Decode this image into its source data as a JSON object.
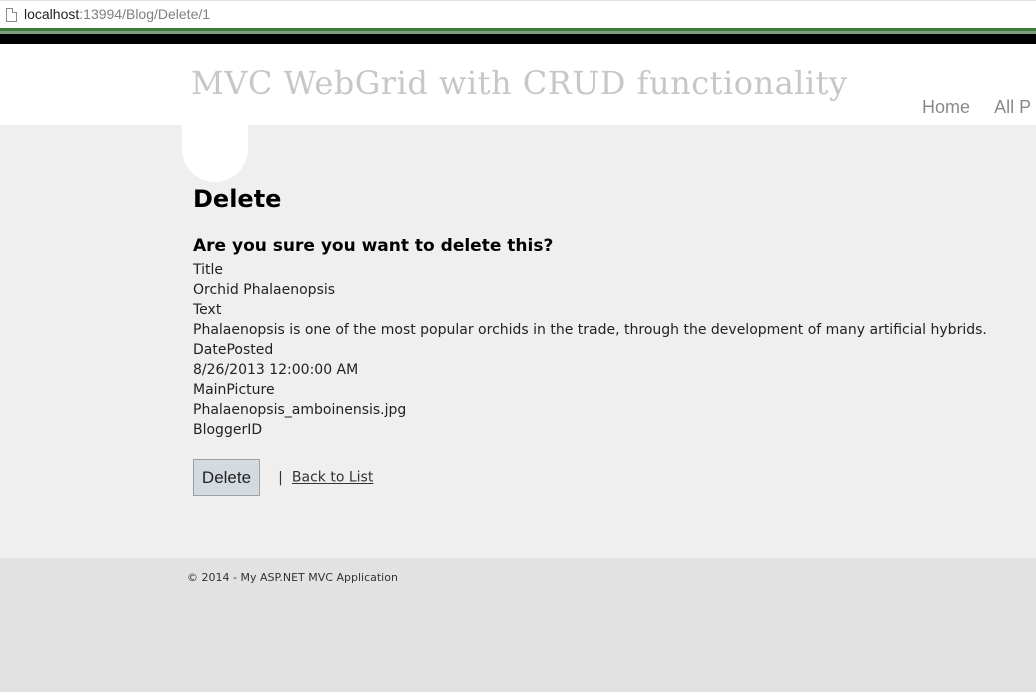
{
  "browser": {
    "url_host": "localhost",
    "url_rest": ":13994/Blog/Delete/1",
    "page_icon": "page-icon"
  },
  "header": {
    "site_title": "MVC WebGrid with CRUD functionality",
    "nav": [
      "Home",
      "All P"
    ]
  },
  "main": {
    "page_title": "Delete",
    "question": "Are you sure you want to delete this?",
    "fields": [
      {
        "label": "Title",
        "value": "Orchid Phalaenopsis"
      },
      {
        "label": "Text",
        "value": "Phalaenopsis is one of the most popular orchids in the trade, through the development of many artificial hybrids."
      },
      {
        "label": "DatePosted",
        "value": "8/26/2013 12:00:00 AM"
      },
      {
        "label": "MainPicture",
        "value": "Phalaenopsis_amboinensis.jpg"
      },
      {
        "label": "BloggerID",
        "value": ""
      }
    ],
    "delete_button": "Delete",
    "separator": "|",
    "back_link": "Back to List"
  },
  "footer": {
    "copyright": "© 2014 - My ASP.NET MVC Application"
  },
  "colors": {
    "title_gray": "#c7c7c7",
    "content_bg": "#efefef",
    "footer_bg": "#e2e2e2",
    "button_bg": "#d3dae0",
    "accent_green": "#3b7a3b"
  }
}
